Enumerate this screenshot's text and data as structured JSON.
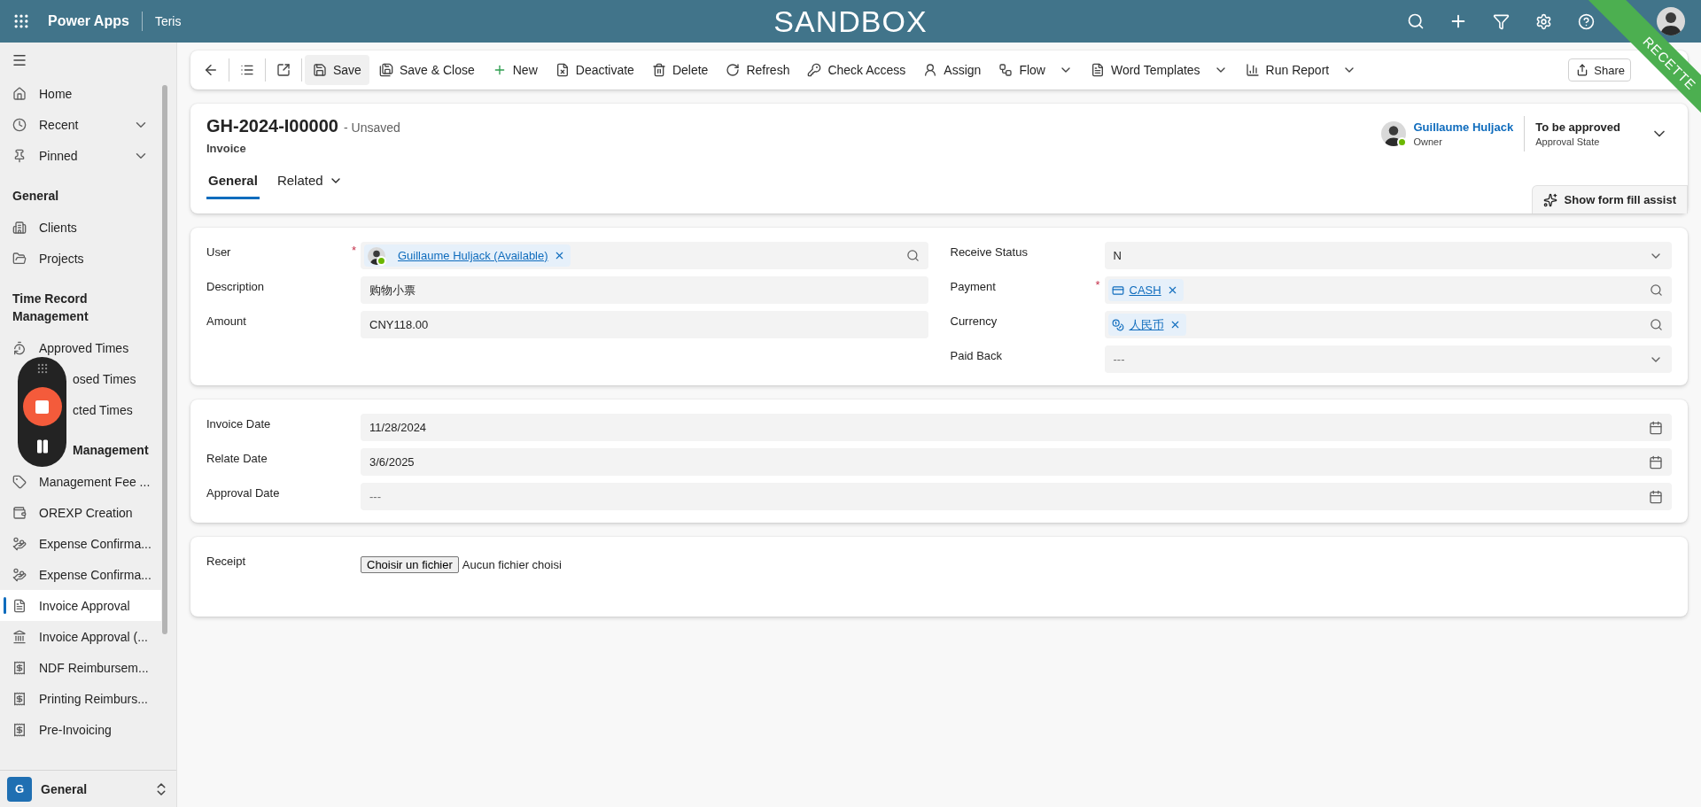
{
  "topbar": {
    "app_name": "Power Apps",
    "environment": "Teris",
    "banner": "SANDBOX",
    "ribbon": "RECETTE"
  },
  "sidebar": {
    "top_items": [
      {
        "label": "Home",
        "expandable": false
      },
      {
        "label": "Recent",
        "expandable": true
      },
      {
        "label": "Pinned",
        "expandable": true
      }
    ],
    "groups": [
      {
        "title": "General",
        "items": [
          {
            "label": "Clients",
            "selected": false,
            "covered": false
          },
          {
            "label": "Projects",
            "selected": false,
            "covered": false
          }
        ]
      },
      {
        "title": "Time Record Management",
        "items": [
          {
            "label": "Approved Times",
            "selected": false,
            "covered": false
          },
          {
            "label": "osed Times",
            "selected": false,
            "covered": true
          },
          {
            "label": "cted Times",
            "selected": false,
            "covered": true
          }
        ]
      },
      {
        "title": "Management",
        "covered": true,
        "items": [
          {
            "label": "Management Fee ...",
            "selected": false,
            "covered": false
          },
          {
            "label": "OREXP Creation",
            "selected": false,
            "covered": false
          },
          {
            "label": "Expense Confirma...",
            "selected": false,
            "covered": false
          },
          {
            "label": "Expense Confirma...",
            "selected": false,
            "covered": false
          },
          {
            "label": "Invoice Approval",
            "selected": true,
            "covered": false
          },
          {
            "label": "Invoice Approval (...",
            "selected": false,
            "covered": false
          },
          {
            "label": "NDF Reimbursem...",
            "selected": false,
            "covered": false
          },
          {
            "label": "Printing Reimburs...",
            "selected": false,
            "covered": false
          },
          {
            "label": "Pre-Invoicing",
            "selected": false,
            "covered": false
          }
        ]
      }
    ],
    "area": {
      "initial": "G",
      "label": "General"
    }
  },
  "command_bar": {
    "items": [
      {
        "label": "Save",
        "selected": true,
        "dropdown": false
      },
      {
        "label": "Save & Close",
        "selected": false,
        "dropdown": false
      },
      {
        "label": "New",
        "selected": false,
        "dropdown": false
      },
      {
        "label": "Deactivate",
        "selected": false,
        "dropdown": false
      },
      {
        "label": "Delete",
        "selected": false,
        "dropdown": false
      },
      {
        "label": "Refresh",
        "selected": false,
        "dropdown": false
      },
      {
        "label": "Check Access",
        "selected": false,
        "dropdown": false
      },
      {
        "label": "Assign",
        "selected": false,
        "dropdown": false
      },
      {
        "label": "Flow",
        "selected": false,
        "dropdown": true
      },
      {
        "label": "Word Templates",
        "selected": false,
        "dropdown": true
      },
      {
        "label": "Run Report",
        "selected": false,
        "dropdown": true
      }
    ],
    "share": "Share"
  },
  "header": {
    "title": "GH-2024-I00000",
    "status": "- Unsaved",
    "entity": "Invoice",
    "owner": {
      "name": "Guillaume Huljack",
      "role": "Owner"
    },
    "approval": {
      "value": "To be approved",
      "label": "Approval State"
    },
    "tabs": [
      {
        "label": "General",
        "selected": true,
        "dropdown": false
      },
      {
        "label": "Related",
        "selected": false,
        "dropdown": true
      }
    ],
    "form_fill_button": "Show form fill assist"
  },
  "sections": [
    {
      "columns": [
        [
          {
            "label": "User",
            "required_mark": "*",
            "kind": "lookup",
            "tag": {
              "kind": "user",
              "text": "Guillaume Huljack (Available)"
            }
          },
          {
            "label": "Description",
            "kind": "text",
            "value": "购物小票"
          },
          {
            "label": "Amount",
            "kind": "text",
            "value": "CNY118.00"
          }
        ],
        [
          {
            "label": "Receive Status",
            "kind": "select",
            "value": "N"
          },
          {
            "label": "Payment",
            "required_mark": "*",
            "kind": "lookup",
            "tag": {
              "kind": "payment",
              "text": "CASH"
            }
          },
          {
            "label": "Currency",
            "kind": "lookup",
            "tag": {
              "kind": "currency",
              "text": "人民币"
            }
          },
          {
            "label": "Paid Back",
            "kind": "select",
            "placeholder": "---"
          }
        ]
      ]
    },
    {
      "columns": [
        [
          {
            "label": "Invoice Date",
            "kind": "date",
            "value": "11/28/2024"
          },
          {
            "label": "Relate Date",
            "kind": "date",
            "value": "3/6/2025"
          },
          {
            "label": "Approval Date",
            "kind": "date",
            "placeholder": "---"
          }
        ]
      ]
    },
    {
      "columns": [
        [
          {
            "label": "Receipt",
            "kind": "file",
            "button": "Choisir un fichier",
            "value": "Aucun fichier choisi"
          }
        ]
      ]
    }
  ]
}
